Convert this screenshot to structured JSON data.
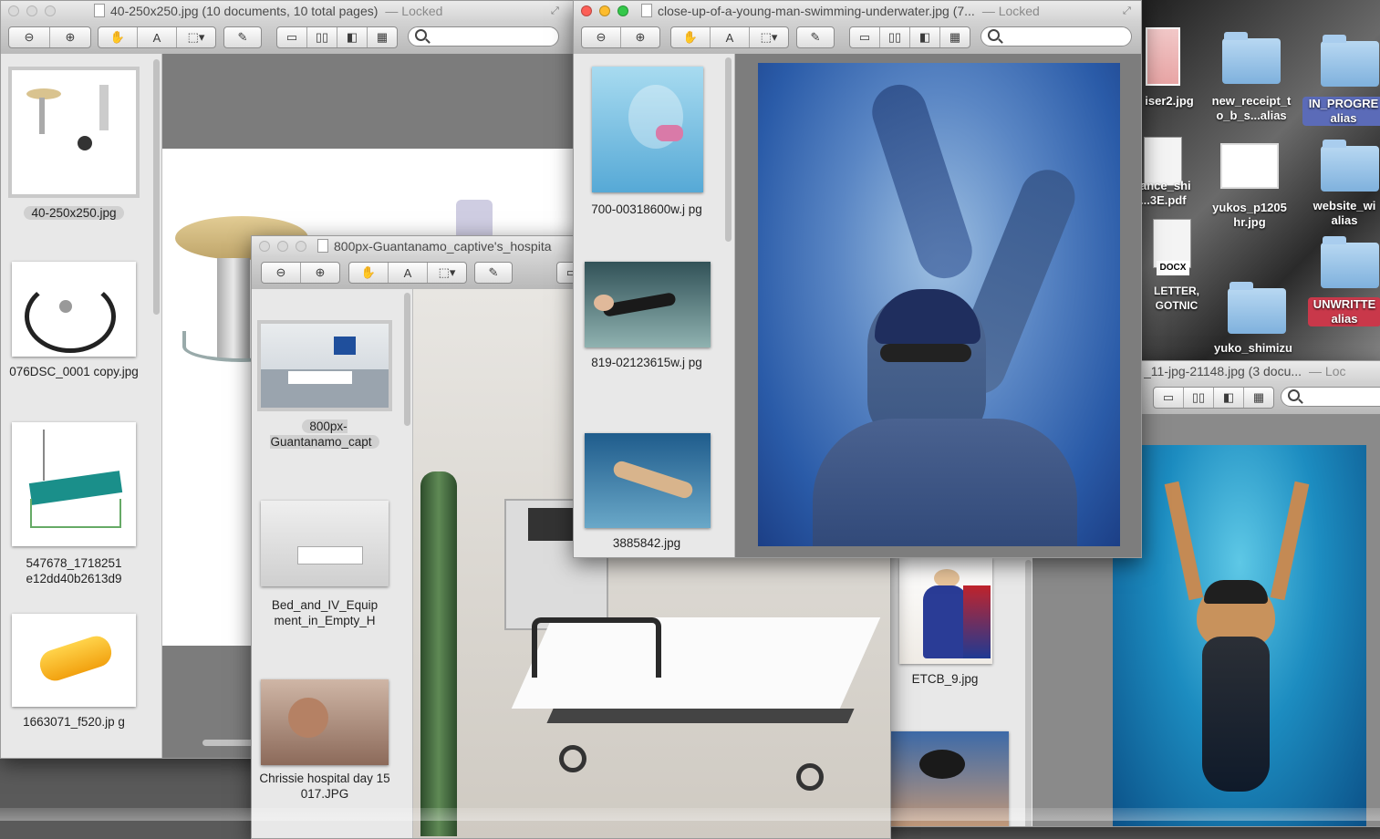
{
  "win1": {
    "title": "40-250x250.jpg (10 documents, 10 total pages)",
    "lock": "— Locked",
    "thumbs": [
      "40-250x250.jpg",
      "076DSC_0001 copy.jpg",
      "547678_1718251 e12dd40b2613d9",
      "1663071_f520.jp g"
    ]
  },
  "win2": {
    "title": "800px-Guantanamo_captive's_hospita",
    "thumbs": [
      "800px- Guantanamo_capt",
      "Bed_and_IV_Equip ment_in_Empty_H",
      "Chrissie hospital day 15 017.JPG"
    ]
  },
  "win3": {
    "title": "close-up-of-a-young-man-swimming-underwater.jpg (7...",
    "lock": "— Locked",
    "thumbs": [
      "700-00318600w.j pg",
      "819-02123615w.j pg",
      "3885842.jpg"
    ]
  },
  "win4": {
    "title": "_11-jpg-21148.jpg (3 docu...",
    "lock": "— Loc",
    "thumbs": [
      "ETCB_9.jpg"
    ]
  },
  "desktop": {
    "items": [
      "iser2.jpg",
      "new_receipt_t o_b_s...alias",
      "IN_PROGRE alias",
      "ance_shi ...3E.pdf",
      "yukos_p1205 hr.jpg",
      "website_wi alias",
      "DOCX",
      "UNWRITTE alias",
      "yuko_shimizu",
      "LETTER, GOTNIC"
    ]
  }
}
